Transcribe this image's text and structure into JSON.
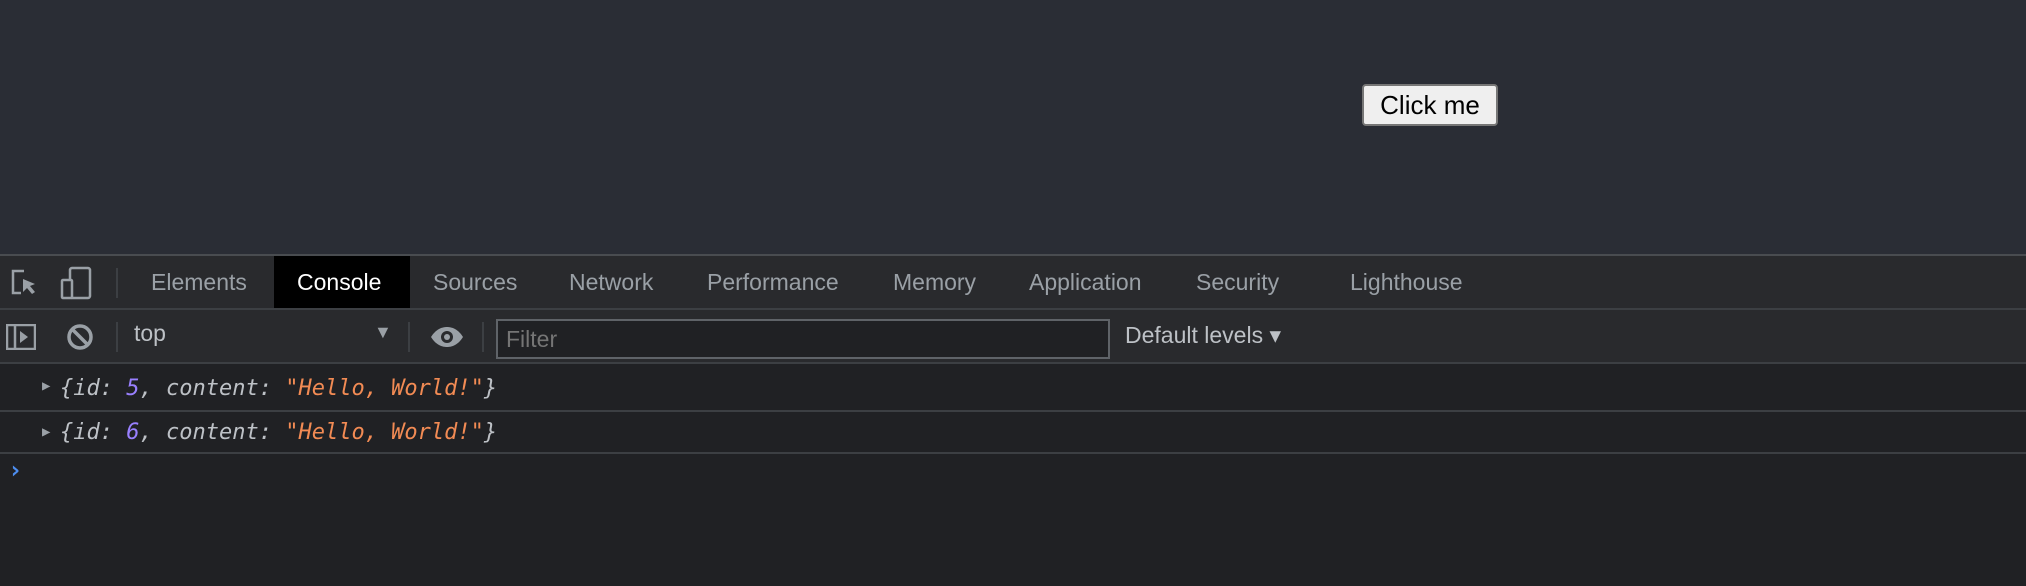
{
  "page": {
    "button_label": "Click me"
  },
  "devtools": {
    "tabs": [
      "Elements",
      "Console",
      "Sources",
      "Network",
      "Performance",
      "Memory",
      "Application",
      "Security",
      "Lighthouse"
    ],
    "active_tab": "Console",
    "toolbar": {
      "context": "top",
      "filter_placeholder": "Filter",
      "levels": "Default levels ▾"
    },
    "console": [
      {
        "id_key": "id",
        "id": "5",
        "content_key": "content",
        "content": "\"Hello, World!\""
      },
      {
        "id_key": "id",
        "id": "6",
        "content_key": "content",
        "content": "\"Hello, World!\""
      }
    ],
    "prompt": "›"
  }
}
